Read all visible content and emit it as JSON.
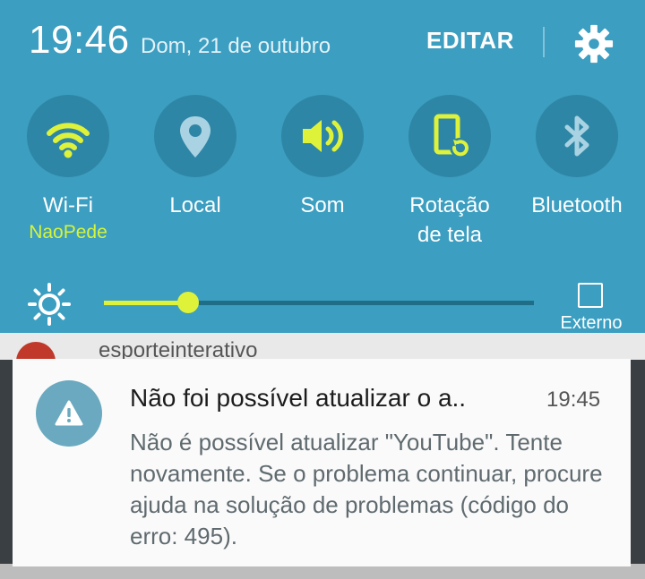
{
  "header": {
    "time": "19:46",
    "date": "Dom, 21 de outubro",
    "edit_label": "EDITAR",
    "settings_icon": "gear-icon"
  },
  "quick_settings": [
    {
      "label": "Wi-Fi",
      "sublabel": "NaoPede",
      "icon": "wifi-icon",
      "active": true
    },
    {
      "label": "Local",
      "icon": "location-pin-icon",
      "active": false
    },
    {
      "label": "Som",
      "icon": "volume-icon",
      "active": true
    },
    {
      "label": "Rotação",
      "label2": "de tela",
      "icon": "screen-rotation-icon",
      "active": true
    },
    {
      "label": "Bluetooth",
      "icon": "bluetooth-icon",
      "active": false
    }
  ],
  "brightness": {
    "icon": "brightness-sun-icon",
    "level": 0.195,
    "external_label": "Externo"
  },
  "background_app": {
    "text": "esporteinterativo"
  },
  "notification": {
    "icon": "warning-icon",
    "title": "Não foi possível atualizar o a..",
    "time": "19:45",
    "body": "Não é possível atualizar \"YouTube\". Tente novamente. Se o problema continuar, procure ajuda na solução de problemas (código do erro: 495)."
  },
  "colors": {
    "panel_bg": "#3c9ec0",
    "button_bg": "#2e86a6",
    "accent": "#dff23a",
    "inactive_icon": "#a9d3e2"
  }
}
